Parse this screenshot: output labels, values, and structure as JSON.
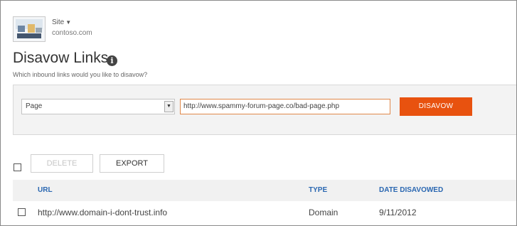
{
  "site": {
    "switcher_label": "Site",
    "url": "contoso.com"
  },
  "page": {
    "title": "Disavow Links",
    "info_icon_glyph": "i",
    "subtitle": "Which inbound links would you like to disavow?"
  },
  "form": {
    "type_select": {
      "selected": "Page",
      "dropdown_glyph": "▼"
    },
    "url_input": {
      "value": "http://www.spammy-forum-page.co/bad-page.php"
    },
    "disavow_label": "DISAVOW",
    "accent_color": "#e8520f"
  },
  "toolbar": {
    "delete_label": "DELETE",
    "export_label": "EXPORT"
  },
  "table": {
    "columns": [
      "URL",
      "TYPE",
      "DATE DISAVOWED"
    ],
    "rows": [
      {
        "url": "http://www.domain-i-dont-trust.info",
        "type": "Domain",
        "date": "9/11/2012"
      }
    ],
    "header_color": "#2a67b1"
  }
}
